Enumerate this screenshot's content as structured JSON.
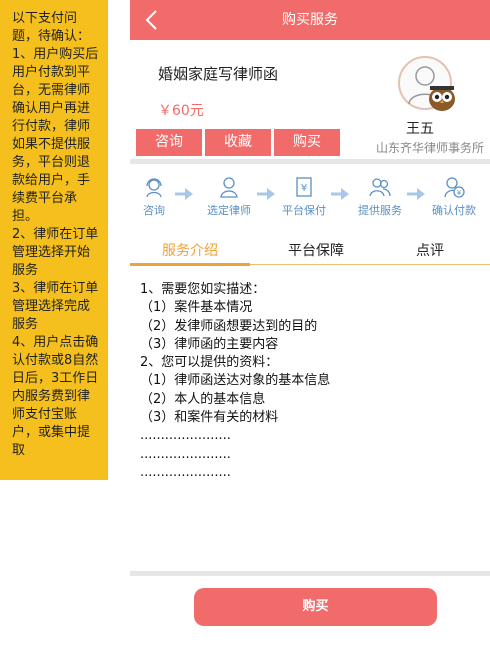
{
  "note": {
    "lines": [
      "以下支付问题，待确认：",
      "1、用户购买后用户付款到平台，无需律师确认用户再进行付款，律师如果不提供服务，平台则退款给用户，手续费平台承担。",
      "2、律师在订单管理选择开始服务",
      "3、律师在订单管理选择完成服务",
      "4、用户点击确认付款或8自然日后，3工作日内服务费到律师支付宝账户，或集中提取"
    ]
  },
  "header": {
    "title": "购买服务",
    "back_icon": "chevron-left-icon"
  },
  "product": {
    "title": "婚姻家庭写律师函",
    "price": "￥60元"
  },
  "actions": {
    "consult": "咨询",
    "favorite": "收藏",
    "buy": "购买"
  },
  "lawyer": {
    "name": "王五",
    "firm": "山东齐华律师事务所"
  },
  "steps": [
    {
      "label": "咨询",
      "icon": "headset-icon"
    },
    {
      "label": "选定律师",
      "icon": "person-icon"
    },
    {
      "label": "平台保付",
      "icon": "yuan-document-icon"
    },
    {
      "label": "提供服务",
      "icon": "people-icon"
    },
    {
      "label": "确认付款",
      "icon": "person-yuan-icon"
    }
  ],
  "tabs": {
    "intro": "服务介绍",
    "guarantee": "平台保障",
    "review": "点评"
  },
  "content": {
    "lines": [
      "1、需要您如实描述：",
      "（1）案件基本情况",
      "（2）发律师函想要达到的目的",
      "（3）律师函的主要内容",
      "2、您可以提供的资料：",
      "（1）律师函送达对象的基本信息",
      "（2）本人的基本信息",
      "（3）和案件有关的材料",
      "......................",
      "......................",
      "......................"
    ]
  },
  "footer": {
    "buy": "购买"
  },
  "colors": {
    "accent": "#f26b6b",
    "note_bg": "#f5c01e",
    "tab_active": "#f0a23a",
    "step_icon": "#5b8fc7"
  }
}
